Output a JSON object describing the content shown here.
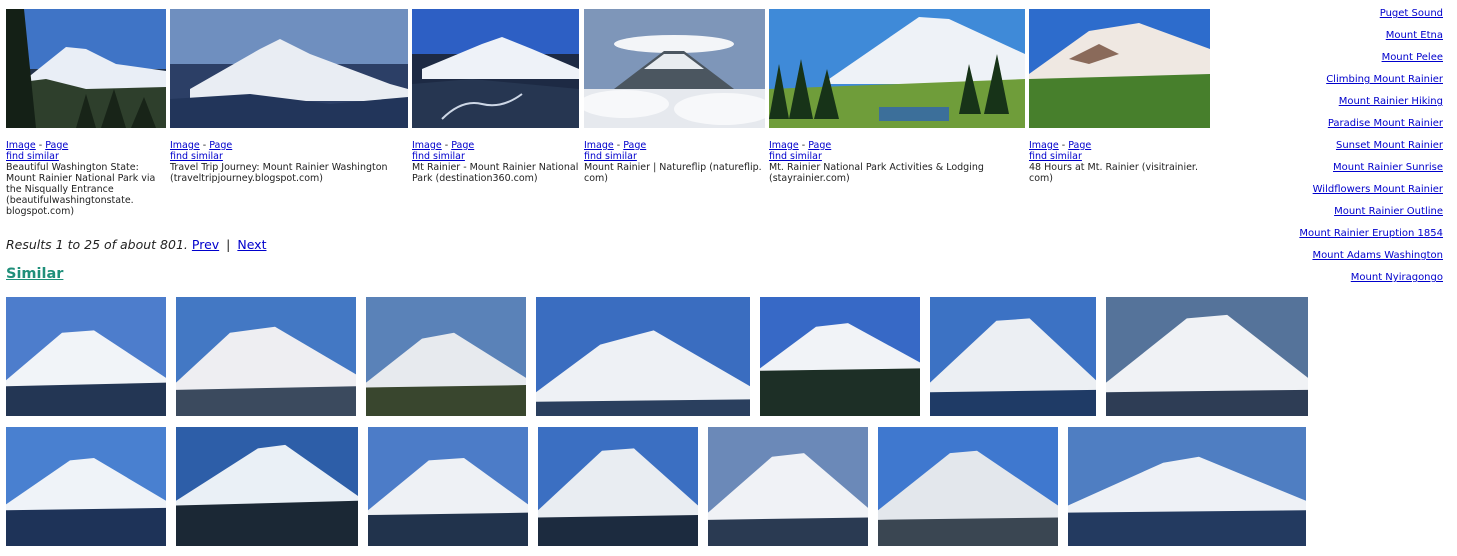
{
  "results": [
    {
      "link_image": "Image",
      "link_page": "Page",
      "link_similar": "find similar",
      "caption": "Beautiful Washington State: Mount Rainier National Park via the Nisqually Entrance (beautifulwashingtonstate. blogspot.com)"
    },
    {
      "link_image": "Image",
      "link_page": "Page",
      "link_similar": "find similar",
      "caption": "Travel Trip Journey: Mount Rainier Washington (traveltripjourney.blogspot.com)"
    },
    {
      "link_image": "Image",
      "link_page": "Page",
      "link_similar": "find similar",
      "caption": "Mt Rainier - Mount Rainier National Park (destination360.com)"
    },
    {
      "link_image": "Image",
      "link_page": "Page",
      "link_similar": "find similar",
      "caption": "Mount Rainier | Natureflip (natureflip. com)"
    },
    {
      "link_image": "Image",
      "link_page": "Page",
      "link_similar": "find similar",
      "caption": "Mt. Rainier National Park Activities & Lodging (stayrainier.com)"
    },
    {
      "link_image": "Image",
      "link_page": "Page",
      "link_similar": "find similar",
      "caption": "48 Hours at Mt. Rainier (visitrainier. com)"
    }
  ],
  "pagination": {
    "summary": "Results 1 to 25 of about 801.",
    "prev": "Prev",
    "separator": "|",
    "next": "Next"
  },
  "similar": {
    "heading": "Similar"
  },
  "related": [
    "Puget Sound",
    "Mount Etna",
    "Mount Pelee",
    "Climbing Mount Rainier",
    "Mount Rainier Hiking",
    "Paradise Mount Rainier",
    "Sunset Mount Rainier",
    "Mount Rainier Sunrise",
    "Wildflowers Mount Rainier",
    "Mount Rainier Outline",
    "Mount Rainier Eruption 1854",
    "Mount Adams Washington",
    "Mount Nyiragongo"
  ],
  "colors": {
    "link": "#0000cc",
    "similar_heading": "#1f8f7a"
  }
}
